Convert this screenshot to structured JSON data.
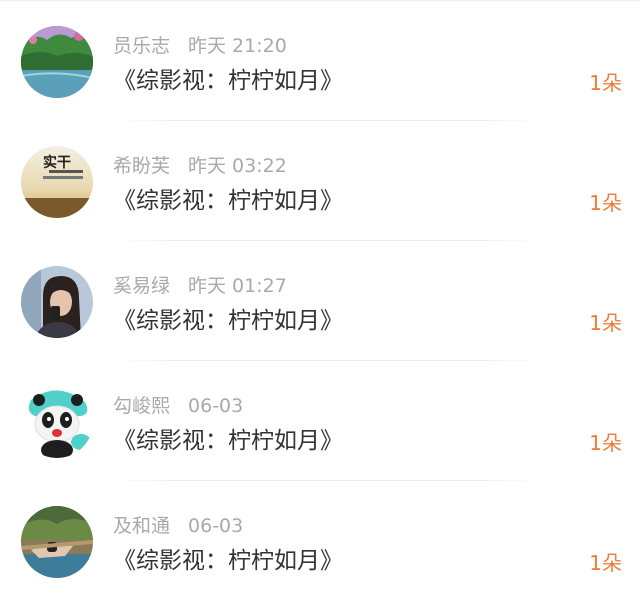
{
  "accent_color": "#f07a3c",
  "items": [
    {
      "name": "员乐志",
      "time": "昨天 21:20",
      "title": "《综影视：柠柠如月》",
      "count": "1朵",
      "avatar": "landscape-avatar"
    },
    {
      "name": "希盼芙",
      "time": "昨天 03:22",
      "title": "《综影视：柠柠如月》",
      "count": "1朵",
      "avatar": "text-sunset-avatar",
      "avatar_text": "实干"
    },
    {
      "name": "奚易绿",
      "time": "昨天 01:27",
      "title": "《综影视：柠柠如月》",
      "count": "1朵",
      "avatar": "selfie-avatar"
    },
    {
      "name": "勾峻熙",
      "time": "06-03",
      "title": "《综影视：柠柠如月》",
      "count": "1朵",
      "avatar": "panda-cartoon-avatar"
    },
    {
      "name": "及和通",
      "time": "06-03",
      "title": "《综影视：柠柠如月》",
      "count": "1朵",
      "avatar": "outdoor-photo-avatar"
    }
  ]
}
